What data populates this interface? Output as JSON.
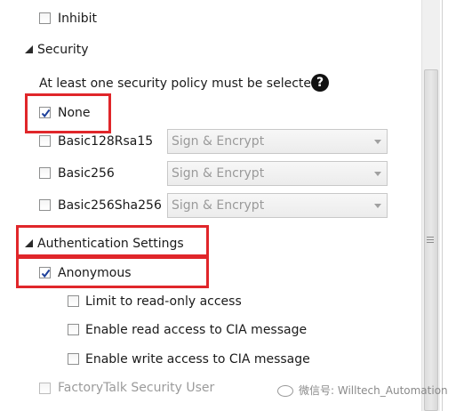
{
  "inhibit": {
    "label": "Inhibit",
    "checked": false
  },
  "security": {
    "heading": "Security",
    "policy_note": "At least one security policy must be selected.",
    "help_icon": "question-circle-icon",
    "policies": [
      {
        "label": "None",
        "checked": true
      },
      {
        "label": "Basic128Rsa15",
        "checked": false,
        "mode": "Sign & Encrypt"
      },
      {
        "label": "Basic256",
        "checked": false,
        "mode": "Sign & Encrypt"
      },
      {
        "label": "Basic256Sha256",
        "checked": false,
        "mode": "Sign & Encrypt"
      }
    ]
  },
  "auth": {
    "heading": "Authentication Settings",
    "anonymous": {
      "label": "Anonymous",
      "checked": true
    },
    "options": [
      {
        "label": "Limit to read-only access",
        "checked": false
      },
      {
        "label": "Enable read access to CIA message",
        "checked": false
      },
      {
        "label": "Enable write access to CIA message",
        "checked": false
      }
    ],
    "factorytalk": {
      "label": "FactoryTalk Security User",
      "checked": false
    }
  },
  "watermark": {
    "text": "微信号: Willtech_Automation"
  },
  "colors": {
    "highlight": "#e0262a",
    "accent_check": "#1c3f9a"
  }
}
